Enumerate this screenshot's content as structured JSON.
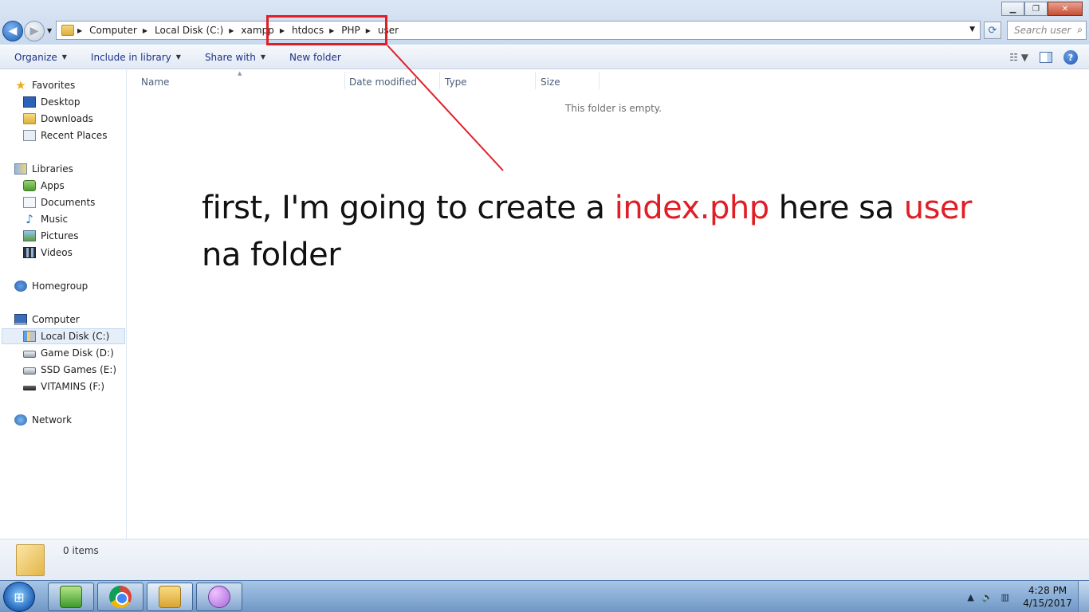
{
  "window": {
    "minimize_glyph": "▁",
    "maximize_glyph": "❐",
    "close_glyph": "✕"
  },
  "address_bar": {
    "crumbs": [
      "Computer",
      "Local Disk (C:)",
      "xampp",
      "htdocs",
      "PHP",
      "user"
    ],
    "search_placeholder": "Search user"
  },
  "command_bar": {
    "organize": "Organize",
    "include_in_library": "Include in library",
    "share_with": "Share with",
    "new_folder": "New folder",
    "help_glyph": "?"
  },
  "nav_pane": {
    "favorites": {
      "label": "Favorites",
      "items": [
        "Desktop",
        "Downloads",
        "Recent Places"
      ]
    },
    "libraries": {
      "label": "Libraries",
      "items": [
        "Apps",
        "Documents",
        "Music",
        "Pictures",
        "Videos"
      ]
    },
    "homegroup": "Homegroup",
    "computer": {
      "label": "Computer",
      "items": [
        "Local Disk (C:)",
        "Game Disk (D:)",
        "SSD Games (E:)",
        "VITAMINS (F:)"
      ],
      "selected": "Local Disk (C:)"
    },
    "network": "Network"
  },
  "columns": [
    "Name",
    "Date modified",
    "Type",
    "Size"
  ],
  "empty_message": "This folder is empty.",
  "annotation": {
    "part1": "first, I'm going to create a ",
    "highlight1": "index.php",
    "part2": " here sa ",
    "highlight2": "user",
    "part3": " na folder",
    "accent_color": "#e01e26"
  },
  "details": {
    "item_count": "0 items"
  },
  "taskbar": {
    "apps": [
      "notepad-plus-plus",
      "chrome",
      "windows-explorer",
      "paint"
    ],
    "clock_time": "4:28 PM",
    "clock_date": "4/15/2017"
  }
}
